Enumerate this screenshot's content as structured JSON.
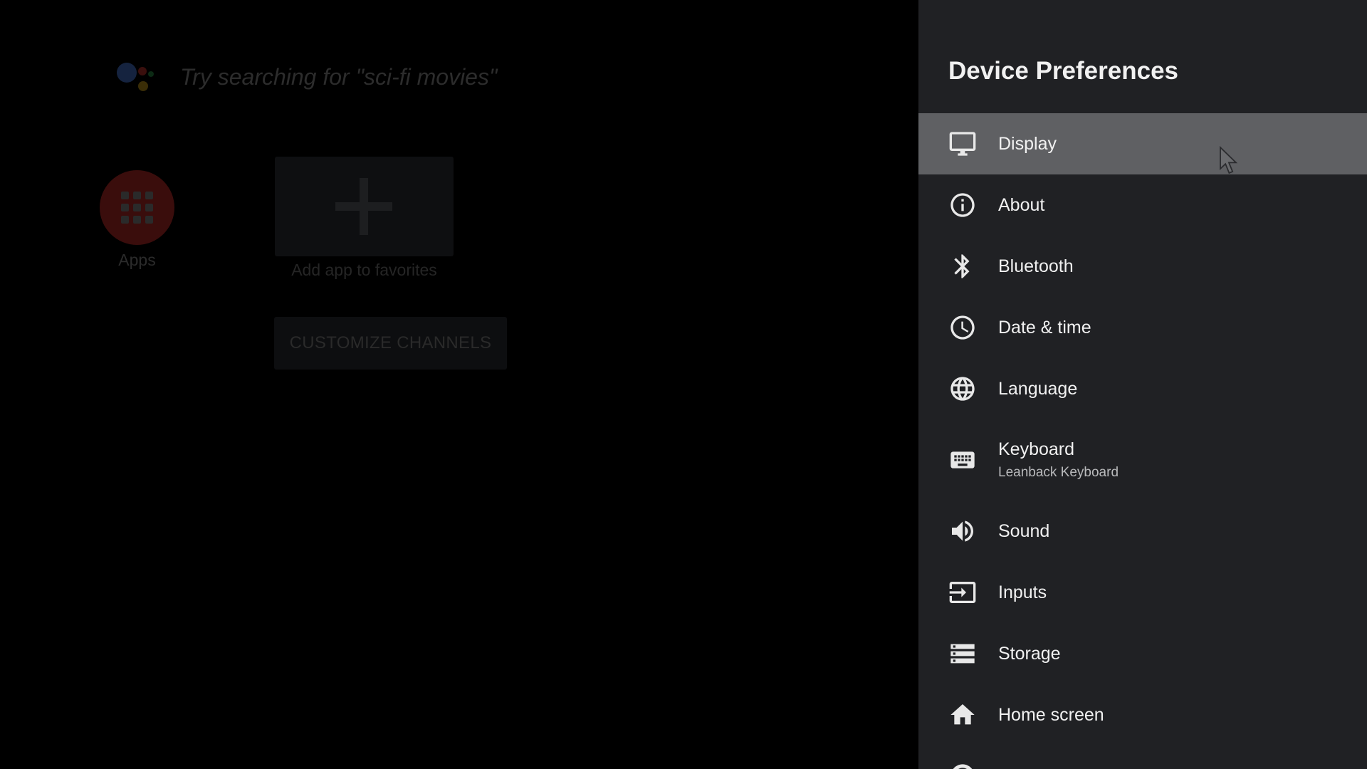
{
  "launcher": {
    "search_hint": "Try searching for \"sci-fi movies\"",
    "apps_label": "Apps",
    "add_favorites_label": "Add app to favorites",
    "customize_channels_label": "CUSTOMIZE CHANNELS"
  },
  "panel": {
    "title": "Device Preferences",
    "items": [
      {
        "label": "Display",
        "icon": "display-icon",
        "selected": true
      },
      {
        "label": "About",
        "icon": "info-icon"
      },
      {
        "label": "Bluetooth",
        "icon": "bluetooth-icon"
      },
      {
        "label": "Date & time",
        "icon": "clock-icon"
      },
      {
        "label": "Language",
        "icon": "globe-icon"
      },
      {
        "label": "Keyboard",
        "sublabel": "Leanback Keyboard",
        "icon": "keyboard-icon"
      },
      {
        "label": "Sound",
        "icon": "speaker-icon"
      },
      {
        "label": "Inputs",
        "icon": "input-icon"
      },
      {
        "label": "Storage",
        "icon": "storage-icon"
      },
      {
        "label": "Home screen",
        "icon": "home-icon"
      }
    ]
  },
  "colors": {
    "panel_bg": "#202124",
    "selected_bg": "#5f6063",
    "text": "#f1f1f1",
    "subtext": "#b9babc"
  }
}
